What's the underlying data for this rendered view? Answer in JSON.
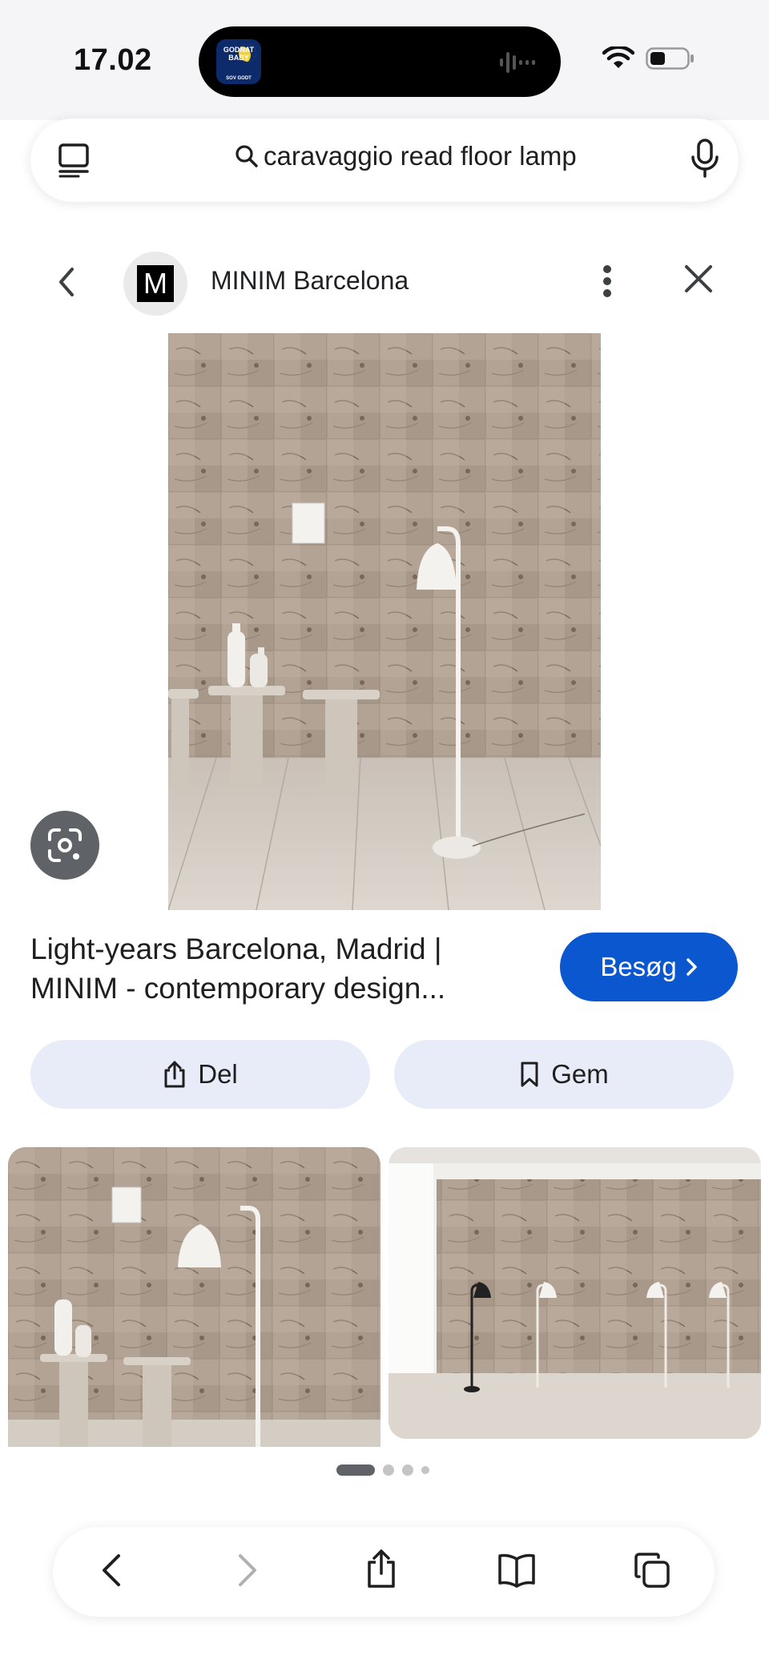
{
  "status_bar": {
    "time": "17.02",
    "island_app_text": "GODNAT BABY",
    "island_app_subtext": "SOV GODT"
  },
  "search": {
    "query": "caravaggio read floor lamp"
  },
  "source": {
    "logo_letter": "M",
    "name": "MINIM Barcelona"
  },
  "result": {
    "title": "Light-years Barcelona, Madrid | MINIM - contemporary design...",
    "visit_label": "Besøg"
  },
  "actions": {
    "share_label": "Del",
    "save_label": "Gem"
  },
  "carousel": {
    "active_index": 0,
    "count": 4
  },
  "colors": {
    "accent": "#0b57d0",
    "action_bg": "#e7ecf8",
    "wood": "#a8978a"
  },
  "icons": {
    "tabs": "tabs-icon",
    "search": "search-icon",
    "mic": "mic-icon",
    "back": "chevron-left-icon",
    "more": "more-vert-icon",
    "close": "close-icon",
    "lens": "google-lens-icon",
    "share": "share-icon",
    "bookmark": "bookmark-icon",
    "toolbar_back": "back-arrow-icon",
    "toolbar_forward": "forward-arrow-icon",
    "toolbar_share": "share-icon",
    "toolbar_bookmarks": "book-icon",
    "toolbar_tabs": "tabs-icon"
  }
}
